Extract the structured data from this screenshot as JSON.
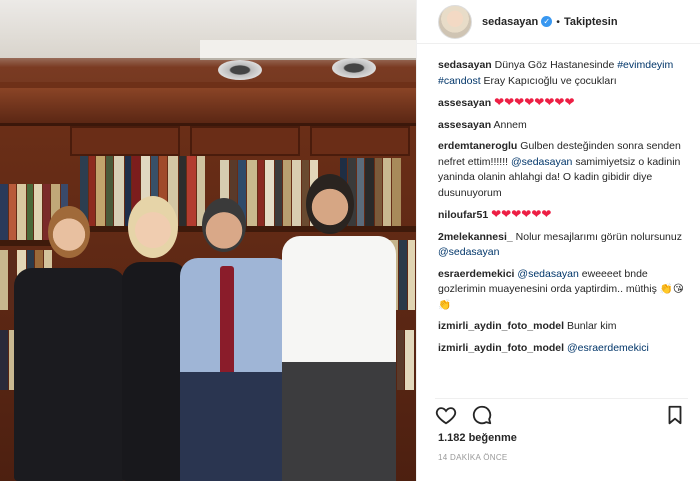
{
  "header": {
    "username": "sedasayan",
    "verified_icon": "verified-badge-icon",
    "separator": "•",
    "follow_label": "Takiptesin"
  },
  "caption": {
    "user": "sedasayan",
    "text1": "Dünya Göz Hastanesinde",
    "tag1": "#evimdeyim",
    "tag2": "#candost",
    "text2": "Eray Kapıcıoğlu ve çocukları"
  },
  "comments": [
    {
      "user": "assesayan",
      "text": "",
      "hearts": 8
    },
    {
      "user": "assesayan",
      "text": "Annem"
    },
    {
      "user": "erdemtaneroglu",
      "text1": "Gulben desteğinden sonra senden nefret ettim!!!!!!",
      "mention": "@sedasayan",
      "text2": "samimiyetsiz o kadinin yaninda olanin ahlahgi da! O kadin gibidir diye dusunuyorum"
    },
    {
      "user": "niloufar51",
      "hearts": 6
    },
    {
      "user": "2melekannesi_",
      "text1": "Nolur mesajlarımı görün nolursunuz",
      "mention": "@sedasayan"
    },
    {
      "user": "esraerdemekici",
      "mention": "@sedasayan",
      "text1": "eweeeet bnde gozlerimin muayenesini orda yaptirdim.. müthiş"
    },
    {
      "user": "izmirli_aydin_foto_model",
      "text1": "Bunlar kim"
    },
    {
      "user": "izmirli_aydin_foto_model",
      "mention": "@esraerdemekici"
    }
  ],
  "actions": {
    "like_icon": "heart-icon",
    "comment_icon": "comment-icon",
    "save_icon": "bookmark-icon"
  },
  "likes": "1.182 beğenme",
  "time": "14 DAKİKA ÖNCE",
  "colors": {
    "link": "#003569",
    "heart": "#ed1f44",
    "verified": "#3897f0"
  }
}
